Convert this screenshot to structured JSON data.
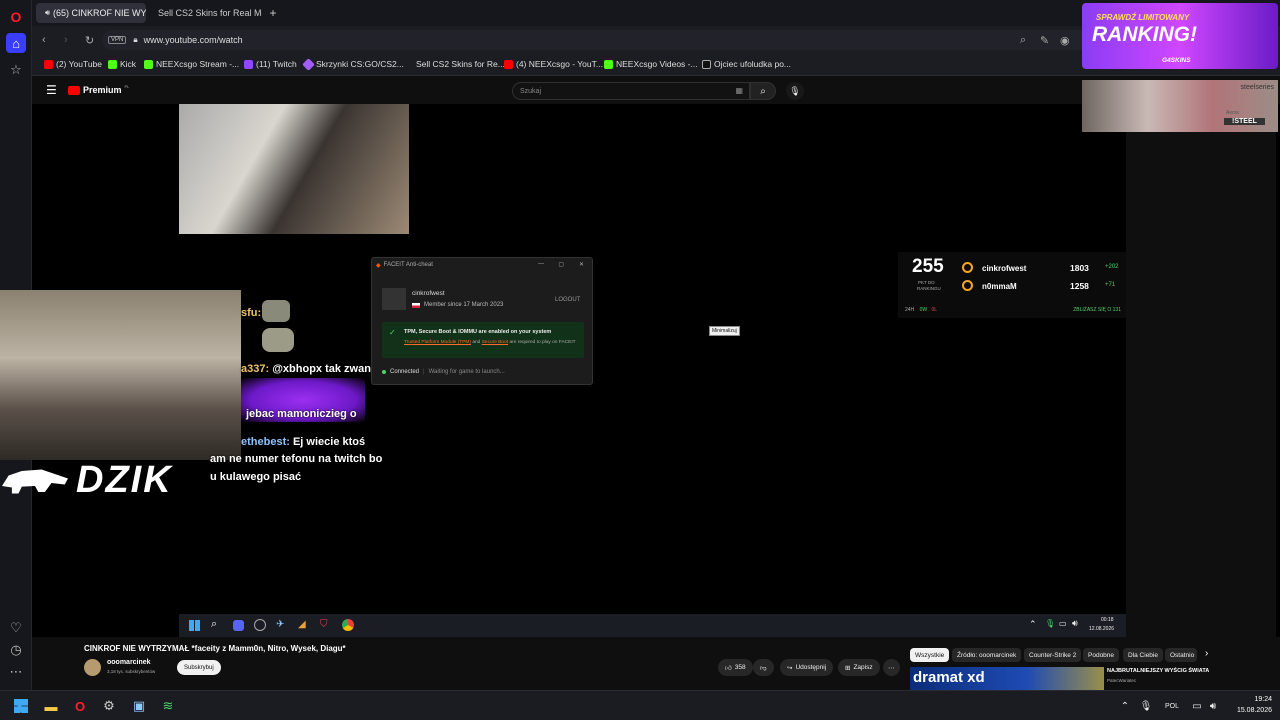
{
  "tabs": [
    {
      "label": "(65) CINKROF NIE WY",
      "active": true
    },
    {
      "label": "Sell CS2 Skins for Real Mo",
      "active": false
    }
  ],
  "address": {
    "url": "www.youtube.com/watch",
    "vpn": "VPN"
  },
  "bookmarks": [
    {
      "label": "(2) YouTube",
      "color": "#ff0000"
    },
    {
      "label": "Kick",
      "color": "#53fc18"
    },
    {
      "label": "NEEXcsgo Stream -...",
      "color": "#53fc18"
    },
    {
      "label": "(11) Twitch",
      "color": "#9146ff"
    },
    {
      "label": "Skrzynki CS:GO/CS2...",
      "color": "#a25cff"
    },
    {
      "label": "Sell CS2 Skins for Re...",
      "color": "#1c1d23"
    },
    {
      "label": "(4) NEEXcsgo - YouT...",
      "color": "#ff0000"
    },
    {
      "label": "NEEXcsgo Videos -...",
      "color": "#53fc18"
    },
    {
      "label": "Ojciec ufoludka po...",
      "color": "#111111"
    }
  ],
  "youtube": {
    "logo": "Premium",
    "logo_sup": "PL",
    "search_placeholder": "Szukaj"
  },
  "ad": {
    "top": "SPRAWDŹ LIMITOWANY",
    "headline": "RANKING!",
    "brand": "G4SKINS",
    "brand2": "steelseries",
    "brand2_sub": "Aerox",
    "badge": "!STEEL"
  },
  "chat": [
    {
      "name": "sfu:",
      "text": ""
    },
    {
      "name": "a337:",
      "text": "@xbhopx tak zwane"
    },
    {
      "name": "",
      "text": "jebac mamoniczieg o"
    },
    {
      "name": "ethebest:",
      "text": "Ej wiecie ktoś"
    },
    {
      "name": "",
      "text": "am ne numer tefonu na twitch bo"
    },
    {
      "name": "",
      "text": "u kulawego pisać"
    }
  ],
  "dzik": "DZIK",
  "facet": {
    "title": "FACEIT Anti-cheat",
    "user": "cinkrofwest",
    "member_since": "Member since 17 March 2023",
    "logout": "LOGOUT",
    "status_title": "TPM, Secure Boot & IOMMU are enabled on your system",
    "status_text_1": "Trusted Platform Module (TPM)",
    "status_text_and": "and",
    "status_text_2": "Secure Boot",
    "status_text_3": "are required to play on FACEIT",
    "connected": "Connected",
    "waiting": "Waiting for game to launch..."
  },
  "tooltip": "Minimalizuj",
  "score": {
    "big": "255",
    "big_sub1": "PKT DO",
    "big_sub2": "RANKINGU",
    "players": [
      {
        "name": "cinkrofwest",
        "elo": "1803",
        "delta": "+202"
      },
      {
        "name": "n0mmaM",
        "elo": "1258",
        "delta": "+71"
      }
    ],
    "footer_left": "24H",
    "footer_w": "0W",
    "footer_l": "0L",
    "footer_right": "ZBLIŻASZ SIĘ O 131"
  },
  "video_taskbar": {
    "time": "00:18",
    "date": "12.08.2026"
  },
  "video_info": {
    "title": "CINKROF NIE WYTRZYMAŁ *faceity z Mamm0n, Nitro, Wysek, Diagu*",
    "channel": "ooomarcinek",
    "subs": "3,18 tys. subskrybentów",
    "subscribe": "Subskrybuj",
    "likes": "358",
    "share": "Udostępnij",
    "save": "Zapisz"
  },
  "chips": [
    "Wszystkie",
    "Źródło: ooomarcinek",
    "Counter-Strike 2",
    "Podobne",
    "Dla Ciebie",
    "Ostatnio"
  ],
  "recommended": {
    "thumb_text": "dramat xd",
    "title": "NAJBRUTALNIEJSZY WYŚCIG ŚWIATA",
    "channel": "PatecWariatec"
  },
  "system_tray": {
    "lang": "POL",
    "time": "19:24",
    "date": "15.08.2026"
  }
}
